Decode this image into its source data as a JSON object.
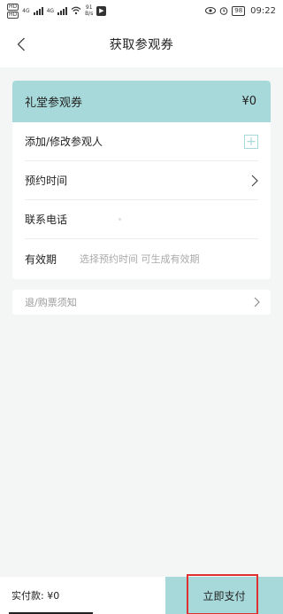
{
  "status_bar": {
    "sim1": "HD",
    "sim2": "HD",
    "net1": "4G",
    "net2": "4G",
    "speed_value": "91",
    "speed_unit": "B/s",
    "battery": "98",
    "time": "09:22"
  },
  "nav": {
    "title": "获取参观券"
  },
  "ticket": {
    "name": "礼堂参观券",
    "price": "¥0"
  },
  "form": {
    "visitors_label": "添加/修改参观人",
    "time_label": "预约时间",
    "phone_label": "联系电话",
    "validity_label": "有效期",
    "validity_hint": "选择预约时间 可生成有效期"
  },
  "notice": {
    "label": "退/购票须知"
  },
  "footer": {
    "paid_label": "实付款:  ¥0",
    "pay_button": "立即支付"
  },
  "colors": {
    "accent": "#a8d9da",
    "highlight": "#e03131"
  }
}
